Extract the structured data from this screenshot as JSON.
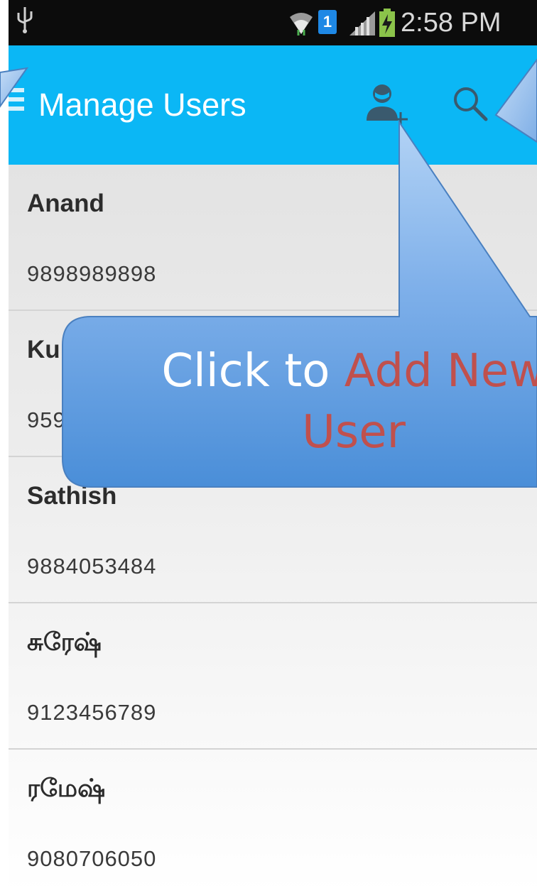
{
  "status_bar": {
    "usb_icon": "usb-icon",
    "wifi_icon": "wifi-icon",
    "sim_label": "1",
    "signal_icon": "signal-icon",
    "battery_icon": "battery-charging-icon",
    "time": "2:58 PM"
  },
  "action_bar": {
    "title": "Manage Users",
    "add_user_icon": "add-user-icon",
    "search_icon": "search-icon",
    "color": "#0bb7f5"
  },
  "users": [
    {
      "name": "Anand",
      "phone": "9898989898"
    },
    {
      "name": "Ku",
      "phone": "959"
    },
    {
      "name": "Sathish",
      "phone": "9884053484"
    },
    {
      "name": "சுரேஷ்",
      "phone": "9123456789"
    },
    {
      "name": "ரமேஷ்",
      "phone": "9080706050"
    }
  ],
  "callout": {
    "prefix": "Click to ",
    "highlight_line1": "Add New",
    "highlight_line2": "User",
    "highlight_color": "#c0504d"
  }
}
